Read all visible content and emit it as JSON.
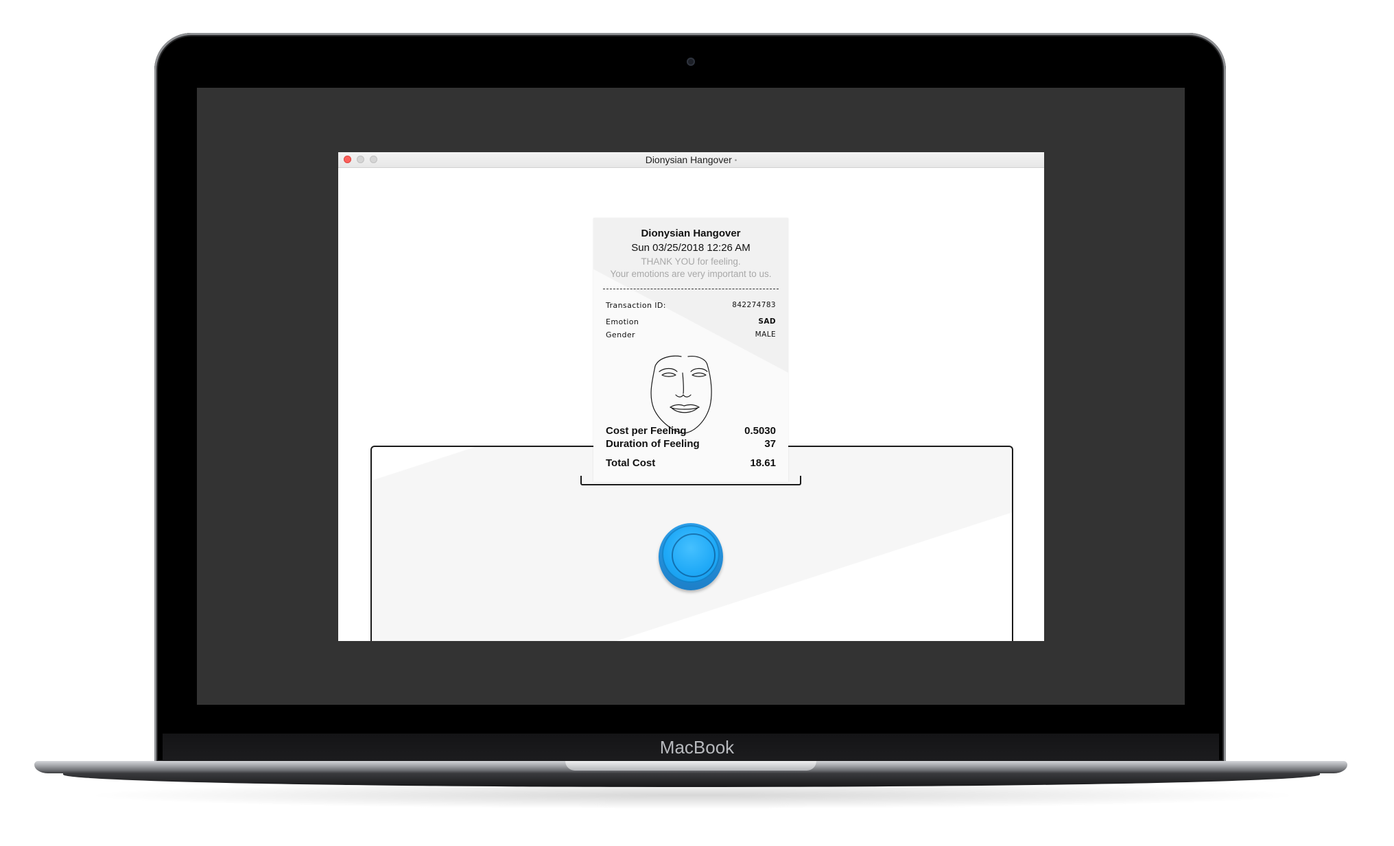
{
  "device": {
    "brand": "MacBook"
  },
  "window": {
    "title": "Dionysian Hangover",
    "edited_indicator": "•"
  },
  "receipt": {
    "title": "Dionysian Hangover",
    "datetime": "Sun 03/25/2018 12:26 AM",
    "thanks": "THANK YOU for feeling.",
    "note": "Your emotions are very important to us.",
    "transaction": {
      "label": "Transaction ID:",
      "value": "842274783"
    },
    "emotion": {
      "label": "Emotion",
      "value": "SAD"
    },
    "gender": {
      "label": "Gender",
      "value": "MALE"
    },
    "face_icon": "face-sketch-icon",
    "cost_per_feeling": {
      "label": "Cost per Feeling",
      "value": "0.5030"
    },
    "duration": {
      "label": "Duration of Feeling",
      "value": "37"
    },
    "total": {
      "label": "Total Cost",
      "value": "18.61"
    }
  },
  "colors": {
    "button_blue": "#1fa9f7",
    "close_red": "#fc605c",
    "screen_bg": "#333333"
  }
}
